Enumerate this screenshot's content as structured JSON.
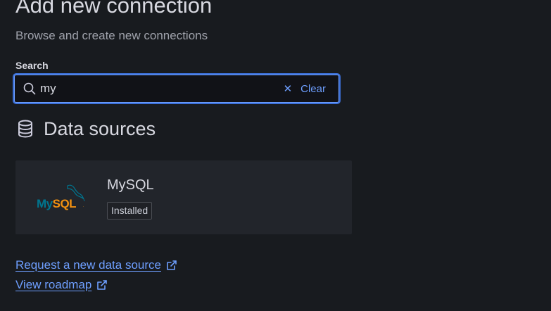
{
  "header": {
    "title": "Add new connection",
    "subtitle": "Browse and create new connections"
  },
  "search": {
    "label": "Search",
    "value": "my",
    "clear_label": "Clear"
  },
  "section": {
    "title": "Data sources"
  },
  "results": [
    {
      "name": "MySQL",
      "badge": "Installed",
      "logo_text": "MySQL"
    }
  ],
  "links": {
    "request": "Request a new data source",
    "roadmap": "View roadmap"
  },
  "colors": {
    "background": "#181b1f",
    "card": "#22252b",
    "accent": "#6e9fff",
    "text_primary": "#d8d9e1",
    "text_secondary": "#9fa2ab",
    "mysql_blue": "#00758f",
    "mysql_orange": "#f29111"
  },
  "icons": {
    "search": "search-icon",
    "clear": "close-icon",
    "section": "database-icon",
    "external": "external-link-icon"
  }
}
